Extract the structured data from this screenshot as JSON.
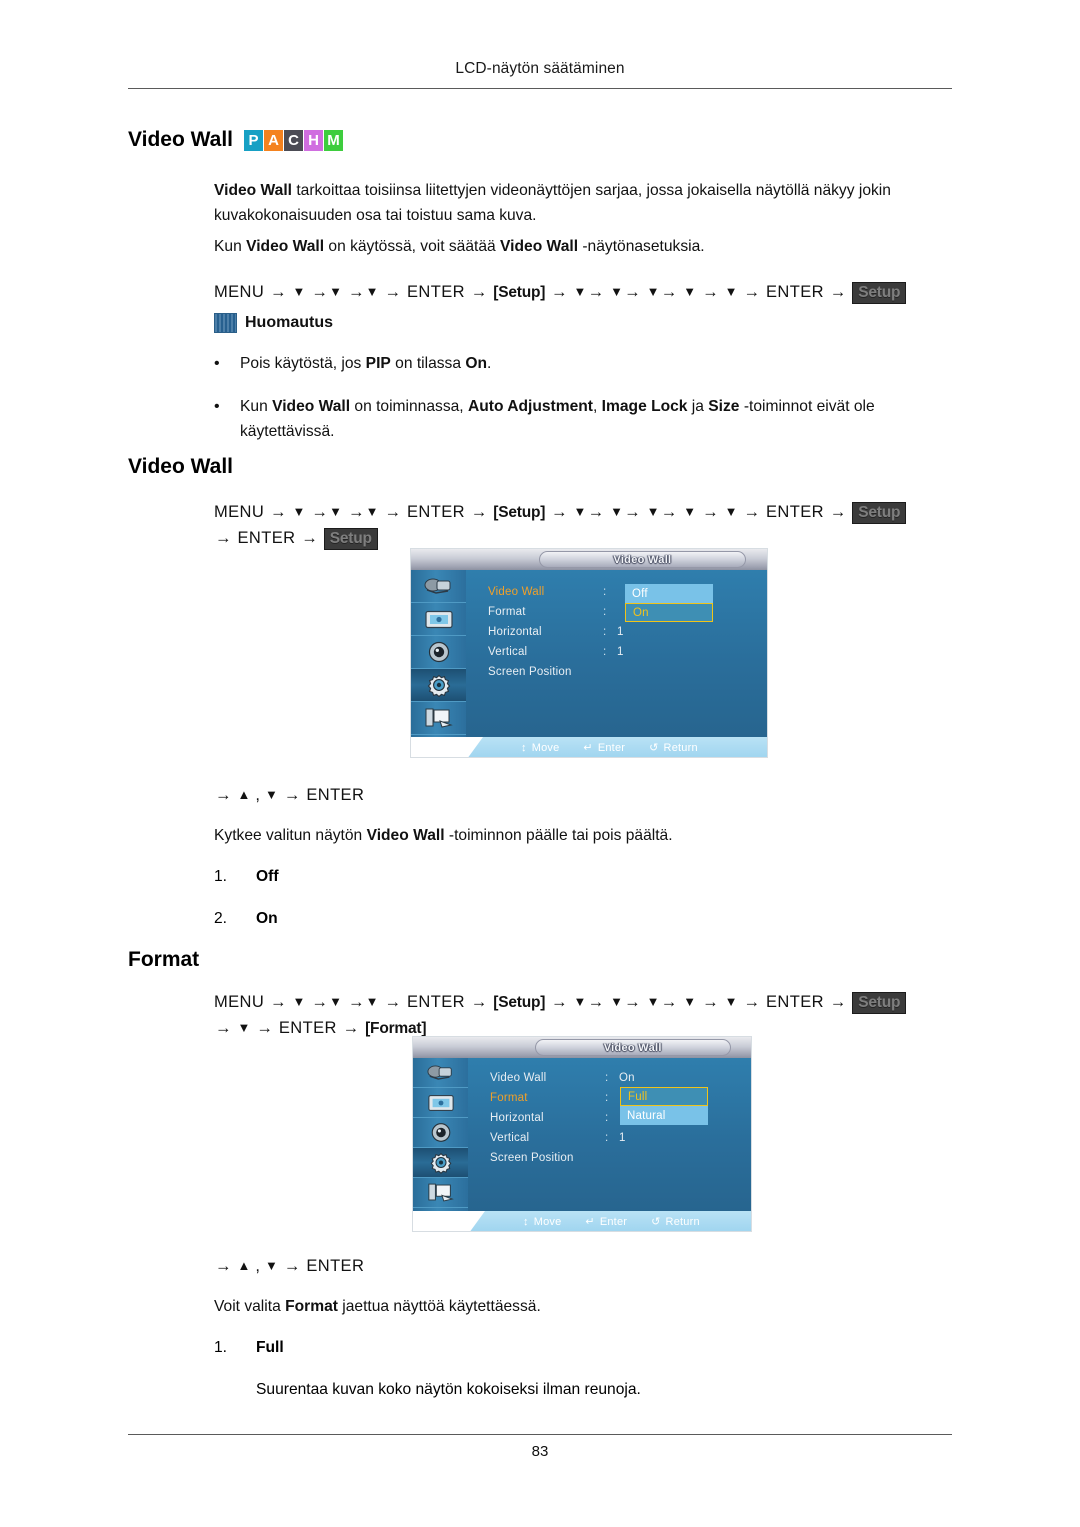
{
  "header": {
    "running_title": "LCD-näytön säätäminen",
    "page_number": "83"
  },
  "badges": [
    {
      "letter": "P",
      "color": "#17a0c4"
    },
    {
      "letter": "A",
      "color": "#f4821f"
    },
    {
      "letter": "C",
      "color": "#4c4c55"
    },
    {
      "letter": "H",
      "color": "#d06ee0"
    },
    {
      "letter": "M",
      "color": "#3ecd3e"
    }
  ],
  "section1": {
    "heading": "Video Wall",
    "intro_bold": "Video Wall",
    "intro_rest": " tarkoittaa toisiinsa liitettyjen videonäyttöjen sarjaa, jossa jokaisella näytöllä näkyy jokin kuvakokonaisuuden osa tai toistuu sama kuva.",
    "usage_pre": "Kun ",
    "usage_bold1": "Video Wall",
    "usage_mid": " on käytössä, voit säätää ",
    "usage_bold2": "Video Wall",
    "usage_post": " -näytönasetuksia.",
    "path": {
      "menu": "MENU",
      "enter": "ENTER",
      "chip_light": "[Setup]",
      "chip_dark": "Setup"
    },
    "note": {
      "title": "Huomautus",
      "bullets": [
        {
          "pre": "Pois käytöstä, jos ",
          "b1": "PIP",
          "mid": " on tilassa ",
          "b2": "On",
          "post": "."
        },
        {
          "pre": "Kun ",
          "b1": "Video Wall",
          "mid": " on toiminnassa, ",
          "b2": "Auto Adjustment",
          "mid2": ", ",
          "b3": "Image Lock",
          "mid3": " ja ",
          "b4": "Size",
          "post": " -toiminnot eivät ole käytettävissä."
        }
      ]
    }
  },
  "section2": {
    "heading": "Video Wall",
    "path": {
      "menu": "MENU",
      "enter": "ENTER",
      "chip_light": "[Setup]",
      "chip_dark": "Setup",
      "line2_enter": "ENTER",
      "line2_chip_dark": "Setup"
    },
    "osd": {
      "title": "Video Wall",
      "rows": [
        {
          "label": "Video Wall",
          "selected": true,
          "colon": ":",
          "value": ""
        },
        {
          "label": "Format",
          "selected": false,
          "colon": ":",
          "value": ""
        },
        {
          "label": "Horizontal",
          "selected": false,
          "colon": ":",
          "value": "1"
        },
        {
          "label": "Vertical",
          "selected": false,
          "colon": ":",
          "value": "1"
        },
        {
          "label": "Screen Position",
          "selected": false,
          "colon": "",
          "value": ""
        }
      ],
      "popup": {
        "options": [
          "Off",
          "On"
        ],
        "focused_index": 1
      },
      "footer": [
        {
          "icon": "updown-arrow-icon",
          "glyph": "↕",
          "label": "Move"
        },
        {
          "icon": "enter-key-icon",
          "glyph": "↵",
          "label": "Enter"
        },
        {
          "icon": "return-arrow-icon",
          "glyph": "↺",
          "label": "Return"
        }
      ]
    },
    "keys_line": {
      "up": "▲",
      "down": "▼",
      "enter": "ENTER"
    },
    "desc_pre": "Kytkee valitun näytön ",
    "desc_bold": "Video Wall",
    "desc_post": " -toiminnon päälle tai pois päältä.",
    "options": [
      {
        "num": "1.",
        "text": "Off"
      },
      {
        "num": "2.",
        "text": "On"
      }
    ]
  },
  "section3": {
    "heading": "Format",
    "path": {
      "menu": "MENU",
      "enter": "ENTER",
      "chip_light": "[Setup]",
      "chip_dark": "Setup",
      "line2_enter": "ENTER",
      "line2_chip_light": "[Format]"
    },
    "osd": {
      "title": "Video Wall",
      "rows": [
        {
          "label": "Video Wall",
          "selected": false,
          "colon": ":",
          "value": "On"
        },
        {
          "label": "Format",
          "selected": true,
          "colon": ":",
          "value": ""
        },
        {
          "label": "Horizontal",
          "selected": false,
          "colon": ":",
          "value": ""
        },
        {
          "label": "Vertical",
          "selected": false,
          "colon": ":",
          "value": "1"
        },
        {
          "label": "Screen Position",
          "selected": false,
          "colon": "",
          "value": ""
        }
      ],
      "popup": {
        "options": [
          "Full",
          "Natural"
        ],
        "focused_index": 0
      },
      "footer": [
        {
          "icon": "updown-arrow-icon",
          "glyph": "↕",
          "label": "Move"
        },
        {
          "icon": "enter-key-icon",
          "glyph": "↵",
          "label": "Enter"
        },
        {
          "icon": "return-arrow-icon",
          "glyph": "↺",
          "label": "Return"
        }
      ]
    },
    "keys_line": {
      "up": "▲",
      "down": "▼",
      "enter": "ENTER"
    },
    "desc_pre": "Voit valita ",
    "desc_bold": "Format",
    "desc_post": " jaettua näyttöä käytettäessä.",
    "options": [
      {
        "num": "1.",
        "text": "Full",
        "detail": "Suurentaa kuvan koko näytön kokoiseksi ilman reunoja."
      }
    ]
  },
  "symbols": {
    "arrow": "→",
    "down": "▼",
    "up": "▲",
    "comma": ","
  }
}
